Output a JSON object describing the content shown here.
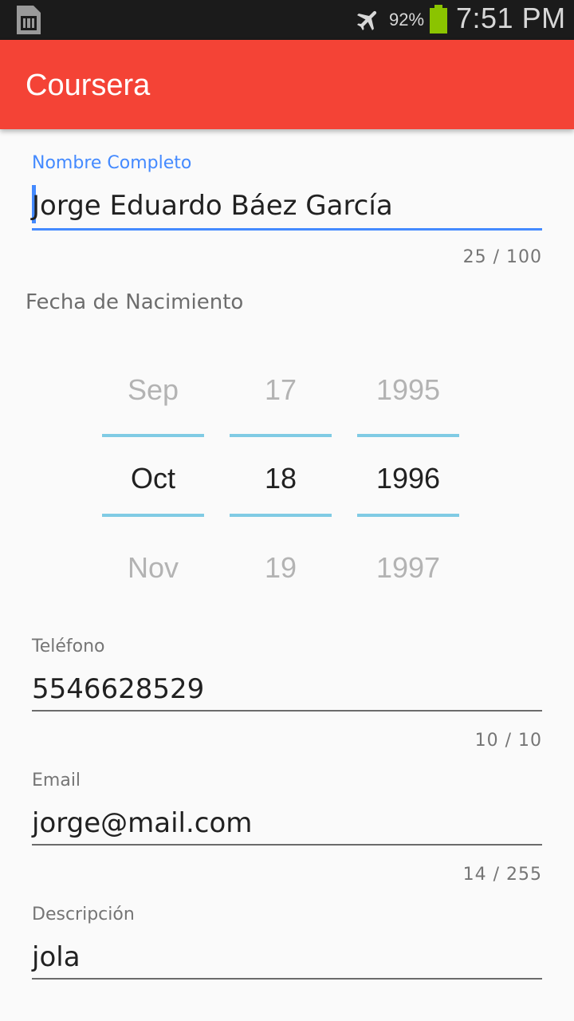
{
  "status_bar": {
    "battery_pct": "92%",
    "time": "7:51 PM",
    "icons": [
      "sim-card-icon",
      "airplane-mode-icon",
      "battery-icon"
    ],
    "battery_color": "#8bc400"
  },
  "app_bar": {
    "title": "Coursera",
    "color": "#f44336"
  },
  "form": {
    "nombre": {
      "label": "Nombre Completo",
      "value": "Jorge Eduardo Báez García",
      "counter": "25 / 100",
      "focused": true
    },
    "fecha": {
      "label": "Fecha de Nacimiento",
      "month": {
        "prev": "Sep",
        "selected": "Oct",
        "next": "Nov"
      },
      "day": {
        "prev": "17",
        "selected": "18",
        "next": "19"
      },
      "year": {
        "prev": "1995",
        "selected": "1996",
        "next": "1997"
      }
    },
    "telefono": {
      "label": "Teléfono",
      "value": "5546628529",
      "counter": "10 / 10"
    },
    "email": {
      "label": "Email",
      "value": "jorge@mail.com",
      "counter": "14 / 255"
    },
    "descripcion": {
      "label": "Descripción",
      "value": "jola"
    }
  },
  "colors": {
    "accent": "#448aff",
    "picker_divider": "#80cbe4"
  }
}
